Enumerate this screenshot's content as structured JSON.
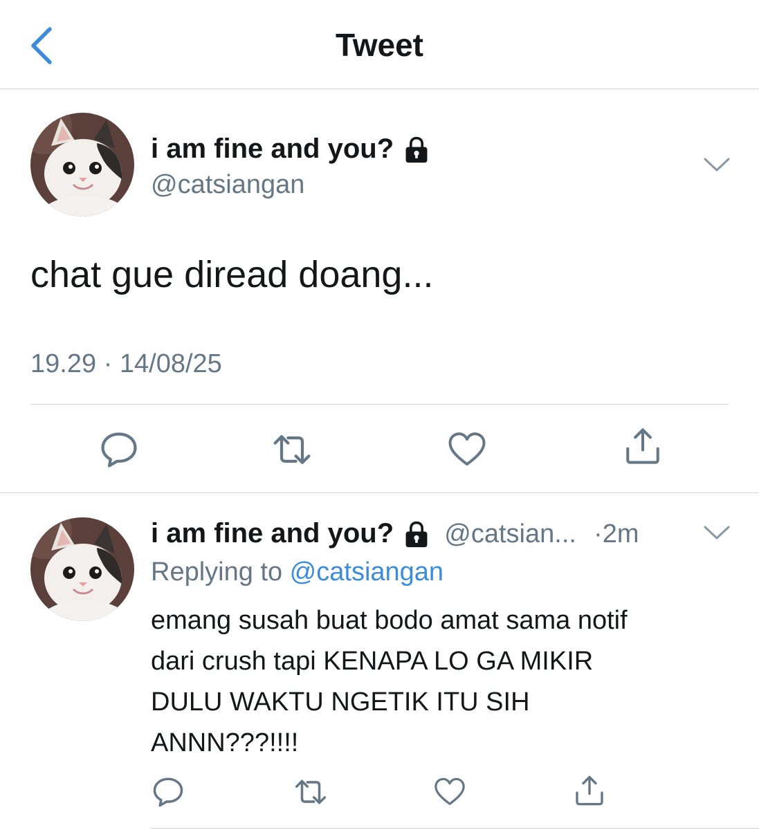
{
  "header": {
    "title": "Tweet",
    "back_icon": "chevron-left-icon"
  },
  "main_tweet": {
    "display_name": "i am fine and you?",
    "handle": "@catsiangan",
    "text": "chat gue diread doang...",
    "timestamp": "19.29 · 14/08/25",
    "actions": [
      "reply-icon",
      "retweet-icon",
      "like-icon",
      "share-icon"
    ]
  },
  "reply_tweet": {
    "display_name": "i am fine and you?",
    "handle": "@catsian...",
    "time": "·2m",
    "replying_prefix": "Replying to ",
    "replying_handle": "@catsiangan",
    "lines": [
      "emang susah buat bodo amat sama notif",
      "dari crush tapi KENAPA LO GA MIKIR",
      "DULU WAKTU NGETIK ITU SIH",
      "ANNN???!!!!"
    ],
    "actions": [
      "reply-icon",
      "retweet-icon",
      "like-icon",
      "share-icon"
    ]
  },
  "colors": {
    "link": "#3b8ddb",
    "secondary": "#657786",
    "text": "#14171a",
    "divider": "#cfd3d6"
  }
}
